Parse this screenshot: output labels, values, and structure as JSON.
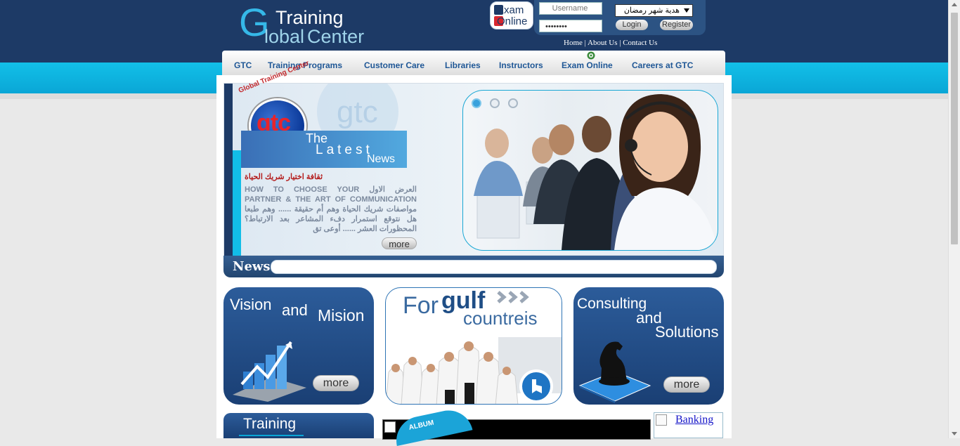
{
  "header": {
    "logo_line1": "Training",
    "logo_g": "G",
    "logo_line2a": "lobal",
    "logo_line2b": "Center",
    "exam_line1": "Exam",
    "exam_line2": "Online",
    "username_placeholder": "Username",
    "password_value": "••••••••",
    "language_select": "هدية شهر رمضان",
    "login_label": "Login",
    "register_label": "Register",
    "toplinks": [
      "Home",
      "About Us",
      "Contact Us"
    ],
    "separator": "|"
  },
  "nav": {
    "items": [
      "GTC",
      "Training Programs",
      "Customer Care",
      "Libraries",
      "Instructors",
      "Exam Online",
      "Careers at GTC"
    ]
  },
  "hero": {
    "badge_ring": "Global Training Center",
    "badge_text": "gtc",
    "latest_1": "The",
    "latest_2": "Latest",
    "latest_3": "News",
    "news_title": "ثقافة اختيار شريك الحياة",
    "news_body": "العرض الاول HOW TO CHOOSE YOUR PARTNER & THE ART OF COMMUNICATION مواصفات شريك الحياة وهم أم حقيقة ...... وهم طبعا هل نتوقع استمرار دفء المشاعر بعد الارتباط؟ المحظورات العشر ...... أوعى تق",
    "more_label": "more",
    "slide_dots": 3,
    "active_dot": 0
  },
  "ticker": {
    "label": "News"
  },
  "cards": {
    "vision_1": "Vision",
    "vision_2": "and",
    "vision_3": "Mision",
    "gulf_1": "For",
    "gulf_2": "gulf",
    "gulf_3": "countreis",
    "consulting_1": "Consulting",
    "consulting_2": "and",
    "consulting_3": "Solutions",
    "more_label": "more"
  },
  "bottom": {
    "training_label": "Training",
    "album_label": "ALBUM",
    "banking_label": "Banking"
  },
  "colors": {
    "navy": "#1d3a66",
    "cyan": "#12c0e8",
    "nav_text": "#1f5796",
    "news_red": "#b41b1b"
  }
}
